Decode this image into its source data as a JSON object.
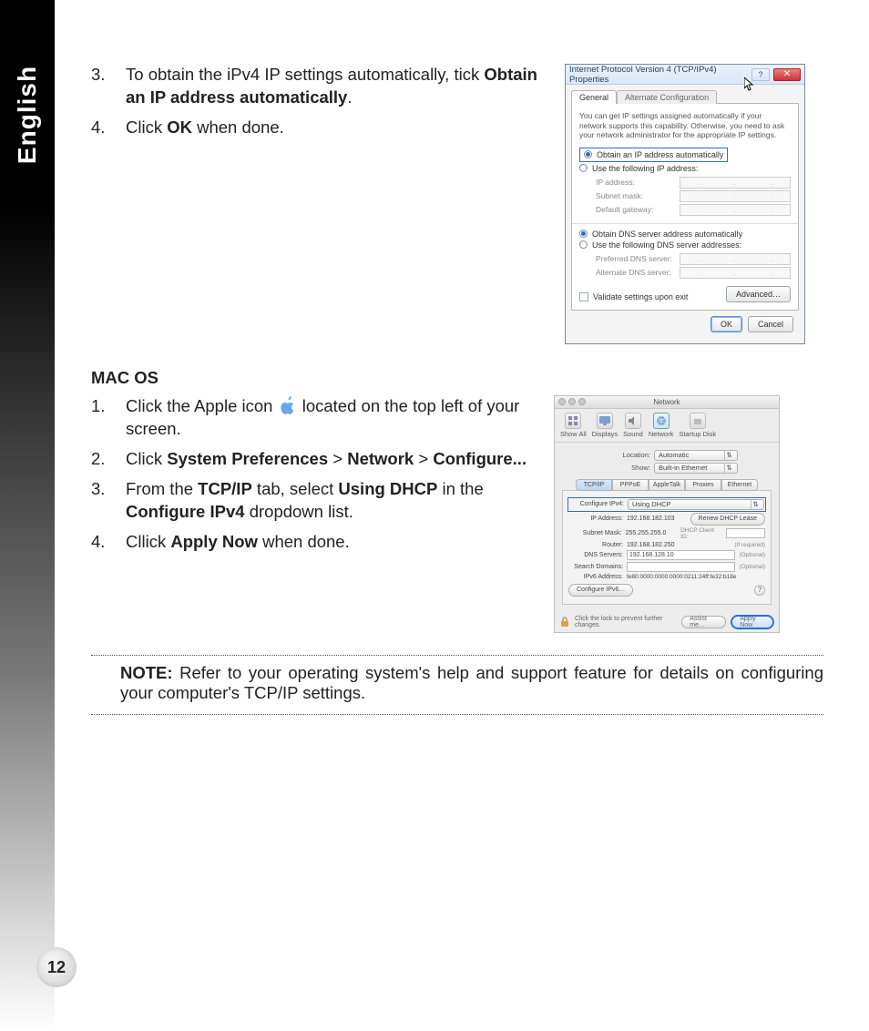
{
  "meta": {
    "language_tab": "English",
    "page_number": "12"
  },
  "section1": {
    "step3_pre": "To obtain the iPv4 IP settings automatically, tick ",
    "step3_bold": "Obtain an IP address automatically",
    "step3_post": ".",
    "step4_pre": "Click ",
    "step4_bold": "OK",
    "step4_post": " when done."
  },
  "macos": {
    "heading": "MAC OS",
    "s1_a": "Click the Apple icon ",
    "s1_b": " located on the top left of your screen.",
    "s2_a": "Click ",
    "s2_b1": "System Preferences",
    "s2_gt1": " > ",
    "s2_b2": "Network",
    "s2_gt2": " > ",
    "s2_b3": "Configure...",
    "s3_a": "From the ",
    "s3_b1": "TCP/IP",
    "s3_b": " tab, select ",
    "s3_b2": "Using DHCP",
    "s3_c": " in the ",
    "s3_b3": "Configure IPv4",
    "s3_d": " dropdown list.",
    "s4_a": "Cllick ",
    "s4_b": "Apply Now",
    "s4_c": " when done."
  },
  "note": {
    "label": "NOTE:",
    "text": "  Refer to your operating system's help and support feature for details on configuring your computer's TCP/IP settings."
  },
  "win": {
    "title": "Internet Protocol Version 4 (TCP/IPv4) Properties",
    "tab_general": "General",
    "tab_alt": "Alternate Configuration",
    "desc": "You can get IP settings assigned automatically if your network supports this capability. Otherwise, you need to ask your network administrator for the appropriate IP settings.",
    "opt_auto_ip": "Obtain an IP address automatically",
    "opt_use_ip": "Use the following IP address:",
    "lbl_ip": "IP address:",
    "lbl_subnet": "Subnet mask:",
    "lbl_gateway": "Default gateway:",
    "opt_auto_dns": "Obtain DNS server address automatically",
    "opt_use_dns": "Use the following DNS server addresses:",
    "lbl_dns1": "Preferred DNS server:",
    "lbl_dns2": "Alternate DNS server:",
    "chk_validate": "Validate settings upon exit",
    "btn_adv": "Advanced…",
    "btn_ok": "OK",
    "btn_cancel": "Cancel"
  },
  "mac": {
    "win_title": "Network",
    "tb": {
      "showall": "Show All",
      "displays": "Displays",
      "sound": "Sound",
      "network": "Network",
      "startup": "Startup Disk"
    },
    "location_lbl": "Location:",
    "location_val": "Automatic",
    "show_lbl": "Show:",
    "show_val": "Built-in Ethernet",
    "tabs": {
      "tcpip": "TCP/IP",
      "pppoe": "PPPoE",
      "appletalk": "AppleTalk",
      "proxies": "Proxies",
      "ethernet": "Ethernet"
    },
    "cfg_lbl": "Configure IPv4:",
    "cfg_val": "Using DHCP",
    "ip_lbl": "IP Address:",
    "ip_val": "192.168.182.103",
    "renew": "Renew DHCP Lease",
    "subnet_lbl": "Subnet Mask:",
    "subnet_val": "255.255.255.0",
    "client_lbl": "DHCP Client ID:",
    "client_hint": "(If required)",
    "router_lbl": "Router:",
    "router_val": "192.168.182.250",
    "dns_lbl": "DNS Servers:",
    "dns_val": "192.168.128.10",
    "optional": "(Optional)",
    "search_lbl": "Search Domains:",
    "ipv6_lbl": "IPv6 Address:",
    "ipv6_val": "fe80:0000:0000:0000:0211:24ff:fe32:b18e",
    "cfg6_btn": "Configure IPv6…",
    "lock_text": "Click the lock to prevent further changes.",
    "assist": "Assist me…",
    "apply": "Apply Now"
  }
}
